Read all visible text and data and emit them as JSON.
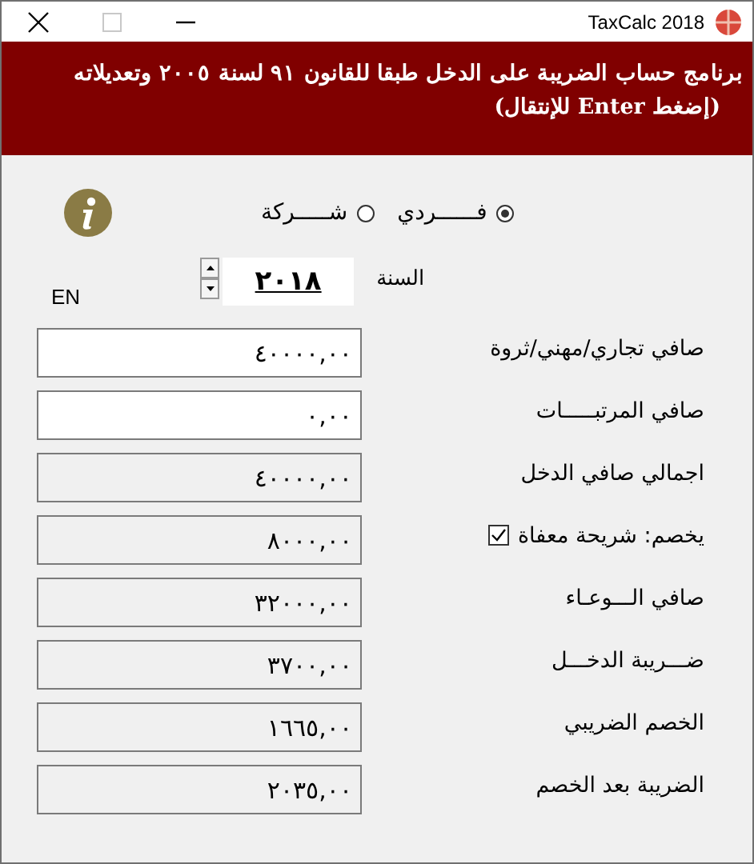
{
  "window": {
    "title": "TaxCalc 2018",
    "controls": [
      {
        "kind": "close",
        "disabled": false
      },
      {
        "kind": "maximize",
        "disabled": true
      },
      {
        "kind": "minimize",
        "disabled": false
      }
    ]
  },
  "header": {
    "lines": [
      "برنامج حساب الضريبة على الدخل طبقا للقانون ٩١ لسنة ٢٠٠٥ وتعديلاته",
      "(إضغط **Enter** للإنتقال)"
    ]
  },
  "taxpayer_type": [
    {
      "label": "فــــــردي",
      "selected": true
    },
    {
      "label": "شـــــركة",
      "selected": false
    }
  ],
  "year": {
    "label": "السنة",
    "value": "٢٠١٨"
  },
  "language_toggle": "EN",
  "fields": [
    {
      "label": "صافي تجاري/مهني/ثروة",
      "value": "٤٠٠٠٠,٠٠",
      "kind": "input"
    },
    {
      "label": "صافي المرتبـــــات",
      "value": "٠,٠٠",
      "kind": "input"
    },
    {
      "label": "اجمالي صافي الدخل",
      "value": "٤٠٠٠٠,٠٠",
      "kind": "readonly"
    },
    {
      "label": "يخصم: شريحة معفاة",
      "value": "٨٠٠٠,٠٠",
      "kind": "readonly",
      "checked": true
    },
    {
      "label": "صافي الـــوعـاء",
      "value": "٣٢٠٠٠,٠٠",
      "kind": "readonly"
    },
    {
      "label": "ضـــريبة الدخـــل",
      "value": "٣٧٠٠,٠٠",
      "kind": "readonly"
    },
    {
      "label": "الخصم الضريبي",
      "value": "١٦٦٥,٠٠",
      "kind": "readonly"
    },
    {
      "label": "الضريبة بعد الخصم",
      "value": "٢٠٣٥,٠٠",
      "kind": "readonly"
    }
  ]
}
